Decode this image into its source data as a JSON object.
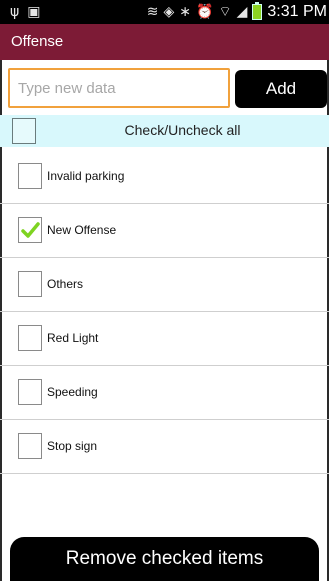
{
  "status_bar": {
    "left_icons": [
      "usb-icon",
      "image-icon"
    ],
    "left_glyphs": [
      "ψ",
      "▣"
    ],
    "right_icons": [
      "nfc-icon",
      "vibrate-icon",
      "bluetooth-icon",
      "alarm-icon",
      "wifi-icon",
      "signal-icon",
      "battery-icon"
    ],
    "right_glyphs": [
      "≋",
      "◈",
      "∗",
      "⏰",
      "⌔",
      "◢"
    ],
    "time": "3:31 PM",
    "battery_color": "#8bd321"
  },
  "action_bar": {
    "title": "Offense",
    "color": "#7d1b36"
  },
  "input": {
    "value": "",
    "placeholder": "Type new data",
    "border_color": "#f1a13c"
  },
  "add_button": {
    "label": "Add"
  },
  "check_all": {
    "label": "Check/Uncheck all",
    "checked": false,
    "background": "#d8f8fc"
  },
  "items": [
    {
      "label": "Invalid parking",
      "checked": false
    },
    {
      "label": "New Offense",
      "checked": true
    },
    {
      "label": "Others",
      "checked": false
    },
    {
      "label": "Red Light",
      "checked": false
    },
    {
      "label": "Speeding",
      "checked": false
    },
    {
      "label": "Stop sign",
      "checked": false
    }
  ],
  "check_color": "#7ed321",
  "remove_button": {
    "label": "Remove checked items"
  }
}
